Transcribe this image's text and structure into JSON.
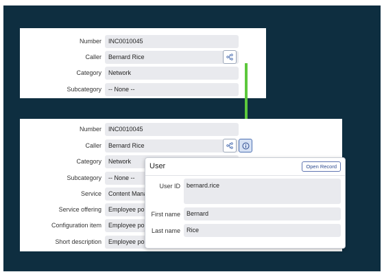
{
  "top_form": {
    "rows": [
      {
        "label": "Number",
        "value": "INC0010045"
      },
      {
        "label": "Caller",
        "value": "Bernard Rice"
      },
      {
        "label": "Category",
        "value": "Network"
      },
      {
        "label": "Subcategory",
        "value": "-- None --"
      }
    ]
  },
  "bottom_form": {
    "rows": [
      {
        "label": "Number",
        "value": "INC0010045"
      },
      {
        "label": "Caller",
        "value": "Bernard Rice"
      },
      {
        "label": "Category",
        "value": "Network"
      },
      {
        "label": "Subcategory",
        "value": "-- None --"
      },
      {
        "label": "Service",
        "value": "Content Management"
      },
      {
        "label": "Service offering",
        "value": "Employee portal"
      },
      {
        "label": "Configuration item",
        "value": "Employee portal"
      },
      {
        "label": "Short description",
        "value": "Employee portal is no"
      }
    ]
  },
  "popup": {
    "title": "User",
    "open_record_label": "Open Record",
    "fields": [
      {
        "label": "User ID",
        "value": "bernard.rice"
      },
      {
        "label": "First name",
        "value": "Bernard"
      },
      {
        "label": "Last name",
        "value": "Rice"
      }
    ]
  },
  "colors": {
    "arrow": "#5cc83c",
    "background": "#0e2e40"
  },
  "icons": {
    "tree": "hierarchy-icon",
    "info": "info-icon"
  }
}
